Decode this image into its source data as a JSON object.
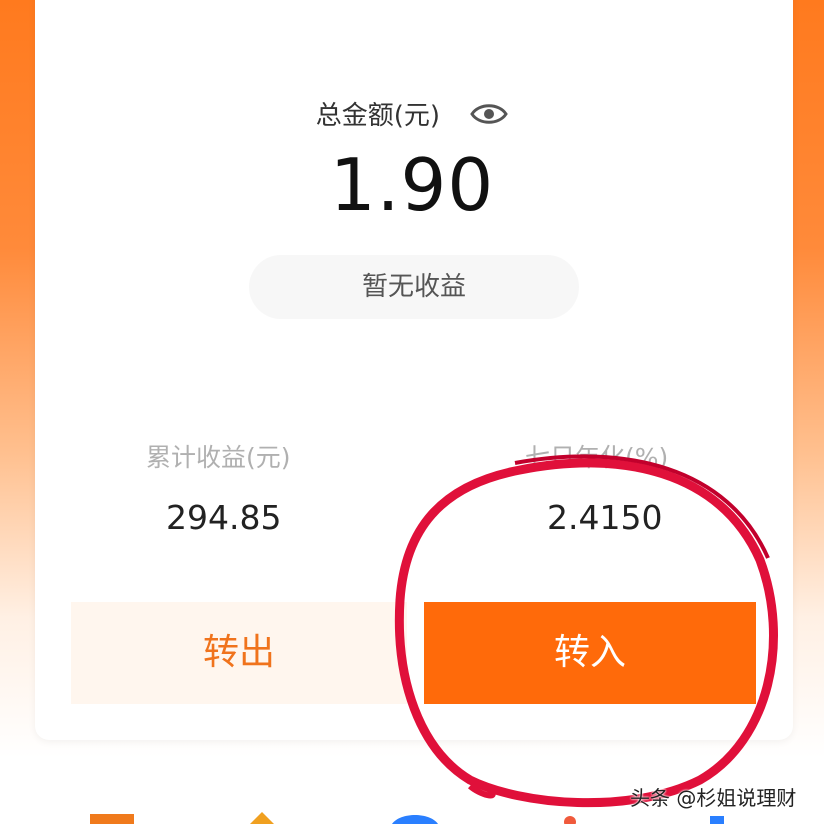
{
  "summary": {
    "total_label": "总金额(元)",
    "amount": "1.90",
    "no_income": "暂无收益"
  },
  "stats": {
    "cumulative": {
      "label": "累计收益(元)",
      "value": "294.85"
    },
    "seven_day": {
      "label": "七日年化(%)",
      "value": "2.4150"
    }
  },
  "actions": {
    "transfer_out": "转出",
    "transfer_in": "转入"
  },
  "watermark": "头条 @杉姐说理财",
  "colors": {
    "brand_orange": "#ff6a0a",
    "annotation_red": "#e0103a"
  },
  "icons": [
    "eye-icon"
  ]
}
